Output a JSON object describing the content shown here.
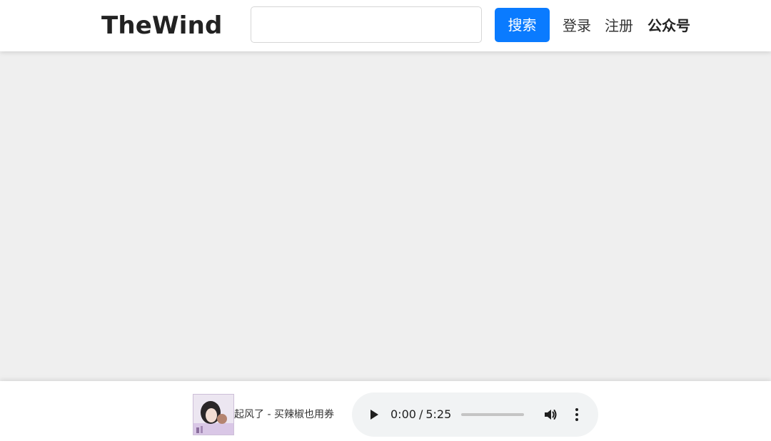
{
  "header": {
    "brand": "TheWind",
    "search": {
      "value": "",
      "placeholder": ""
    },
    "search_button_label": "搜索",
    "nav": {
      "login": "登录",
      "register": "注册",
      "official_account": "公众号"
    }
  },
  "player": {
    "song_title": "起风了 - 买辣椒也用券",
    "current_time": "0:00",
    "time_separator": "/",
    "duration": "5:25",
    "progress_fraction": 0.0,
    "icons": {
      "play": "play-icon",
      "volume": "volume-icon",
      "more": "more-options-icon",
      "cover": "album-cover"
    }
  },
  "colors": {
    "accent": "#0a7bff",
    "page_background": "#efefef",
    "bar_background": "#ffffff",
    "audio_background": "#f1f3f4"
  }
}
